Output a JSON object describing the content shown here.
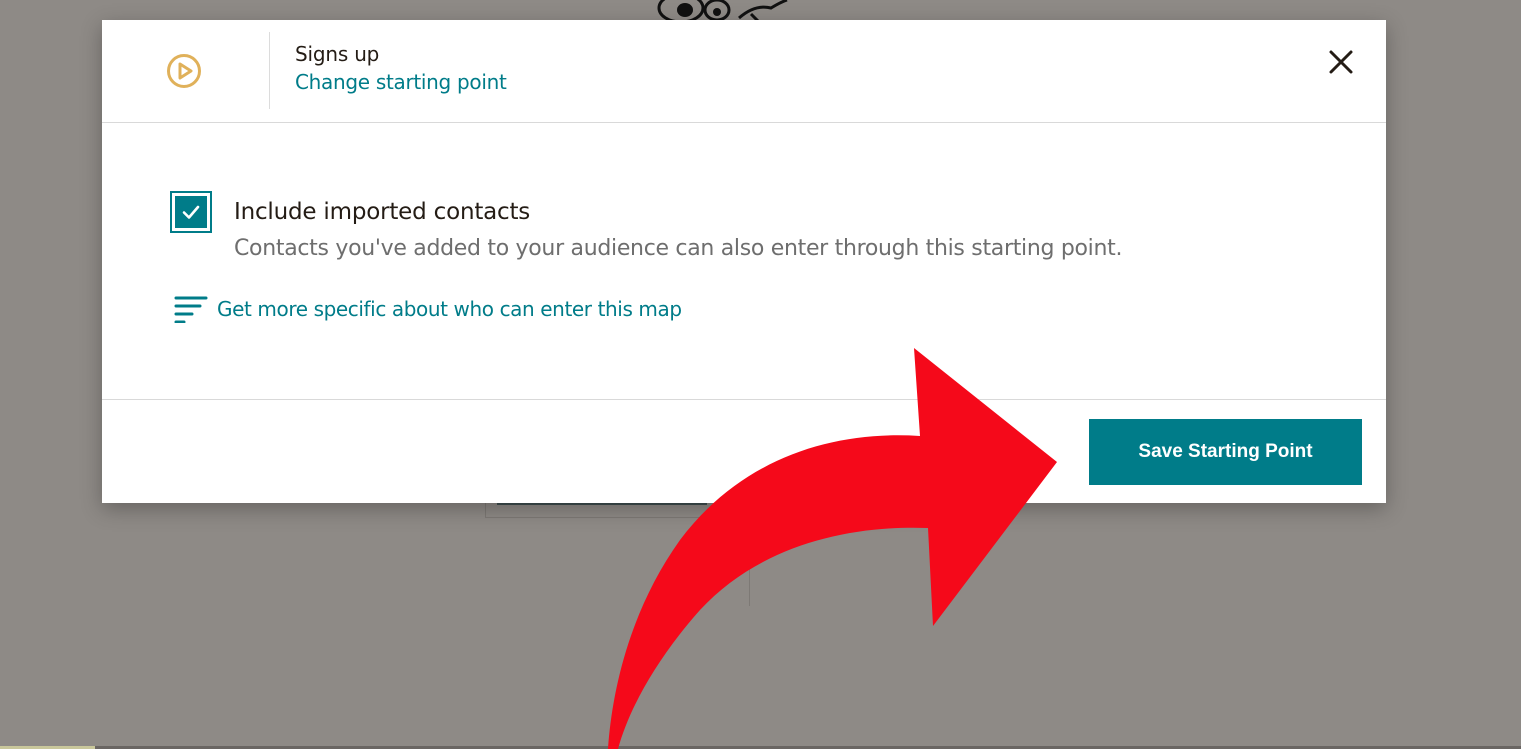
{
  "modal": {
    "header": {
      "title": "Signs up",
      "link": "Change starting point"
    },
    "body": {
      "checkbox": {
        "label": "Include imported contacts",
        "description": "Contacts you've added to your audience can also enter through this starting point.",
        "checked": true
      },
      "filter_link": "Get more specific about who can enter this map"
    },
    "footer": {
      "save_label": "Save Starting Point"
    }
  },
  "icons": {
    "header_icon": "play-circle-icon",
    "close": "close-icon",
    "checkbox_mark": "check-icon",
    "filter": "filter-lines-icon",
    "annotation": "red-curved-arrow"
  },
  "colors": {
    "accent": "#007c89",
    "play_icon": "#e0b15a",
    "overlay": "#8e8a86",
    "annotation_arrow": "#f5091a",
    "text_primary": "#241c15",
    "text_secondary": "#6e6e6e"
  }
}
